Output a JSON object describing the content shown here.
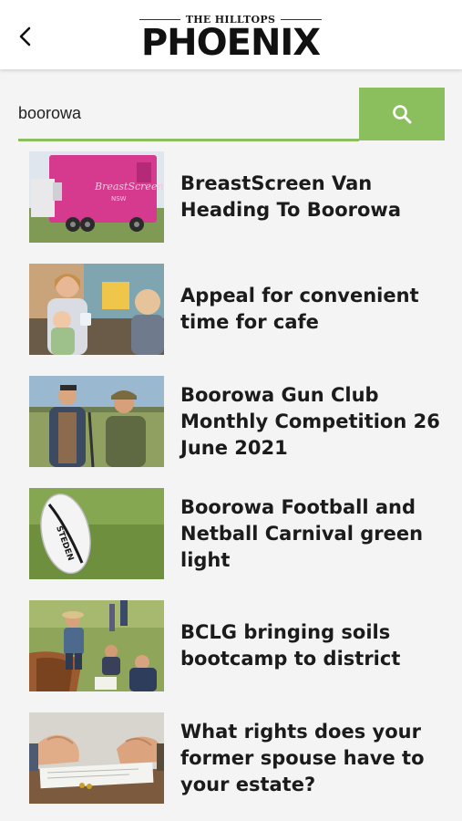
{
  "header": {
    "logo_top": "THE HILLTOPS",
    "logo_main": "PHOENIX",
    "back_icon": "chevron-left-icon"
  },
  "search": {
    "value": "boorowa",
    "button_icon": "search-icon",
    "accent_color": "#8bbf5e"
  },
  "results": [
    {
      "title": "BreastScreen Van Heading To Boorowa",
      "thumb": "pink mobile screening van"
    },
    {
      "title": "Appeal for convenient time for cafe",
      "thumb": "women and child at cafe"
    },
    {
      "title": "Boorowa Gun Club Monthly Competition 26 June 2021",
      "thumb": "two men in field"
    },
    {
      "title": "Boorowa Football and Netball Carnival green light",
      "thumb": "rugby ball on grass"
    },
    {
      "title": "BCLG bringing soils bootcamp to district",
      "thumb": "people at soil pit"
    },
    {
      "title": "What rights does your former spouse have to your estate?",
      "thumb": "clasped hands over documents"
    }
  ]
}
